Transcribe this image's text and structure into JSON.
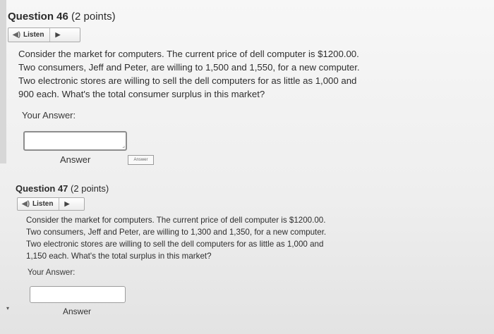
{
  "q1": {
    "number": "Question 46",
    "points": "(2 points)",
    "listen": "Listen",
    "lines": [
      "Consider the market for computers.  The current price of dell computer is $1200.00.",
      "Two consumers, Jeff and Peter, are willing to 1,500 and 1,550, for a new computer.",
      "Two electronic stores are willing to sell the dell computers for as little as 1,000 and",
      "900 each.  What's the total consumer surplus in this market?"
    ],
    "your_answer": "Your Answer:",
    "answer_value": "",
    "answer_label": "Answer",
    "answer_btn": "Answer"
  },
  "q2": {
    "number": "Question 47",
    "points": "(2 points)",
    "listen": "Listen",
    "lines": [
      "Consider the market for computers.  The current price of dell computer is $1200.00.",
      "Two consumers, Jeff and Peter, are willing to 1,300 and 1,350, for a new computer.",
      "Two electronic stores are willing to sell the dell computers for as little as 1,000 and",
      "1,150 each.  What's the total surplus in this market?"
    ],
    "your_answer": "Your Answer:",
    "answer_value": "",
    "answer_label": "Answer"
  },
  "icons": {
    "speaker": "speaker-icon",
    "play": "play-icon"
  }
}
